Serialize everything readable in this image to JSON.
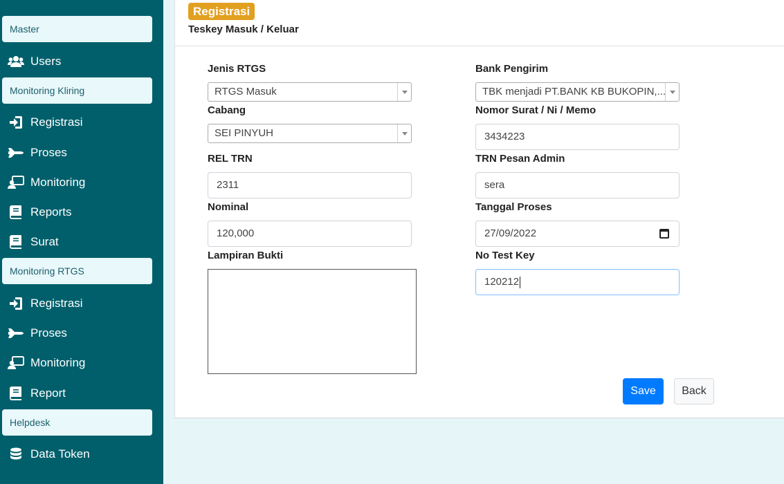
{
  "sidebar": {
    "sections": {
      "master": "Master",
      "kliring": "Monitoring Kliring",
      "rtgs": "Monitoring RTGS",
      "helpdesk": "Helpdesk"
    },
    "items": {
      "users": "Users",
      "kliring_registrasi": "Registrasi",
      "kliring_proses": "Proses",
      "kliring_monitoring": "Monitoring",
      "kliring_reports": "Reports",
      "kliring_surat": "Surat",
      "rtgs_registrasi": "Registrasi",
      "rtgs_proses": "Proses",
      "rtgs_monitoring": "Monitoring",
      "rtgs_report": "Report",
      "data_token": "Data Token"
    }
  },
  "header": {
    "badge": "Registrasi",
    "subtitle": "Teskey Masuk / Keluar"
  },
  "form": {
    "jenis_rtgs": {
      "label": "Jenis RTGS",
      "value": "RTGS Masuk"
    },
    "bank_pengirim": {
      "label": "Bank Pengirim",
      "value": "TBK menjadi PT.BANK KB BUKOPIN,..."
    },
    "cabang": {
      "label": "Cabang",
      "value": "SEI PINYUH"
    },
    "nomor_surat": {
      "label": "Nomor Surat / Ni / Memo",
      "value": "3434223"
    },
    "rel_trn": {
      "label": "REL TRN",
      "value": "2311"
    },
    "trn_pesan_admin": {
      "label": "TRN Pesan Admin",
      "value": "sera"
    },
    "nominal": {
      "label": "Nominal",
      "value": "120,000"
    },
    "tanggal_proses": {
      "label": "Tanggal Proses",
      "value": "27/09/2022"
    },
    "lampiran_bukti": {
      "label": "Lampiran Bukti"
    },
    "no_test_key": {
      "label": "No Test Key",
      "value": "120212"
    }
  },
  "actions": {
    "save": "Save",
    "back": "Back"
  },
  "colors": {
    "sidebar_bg": "#005f6b",
    "badge_bg": "#e2a021",
    "primary": "#007bff"
  }
}
